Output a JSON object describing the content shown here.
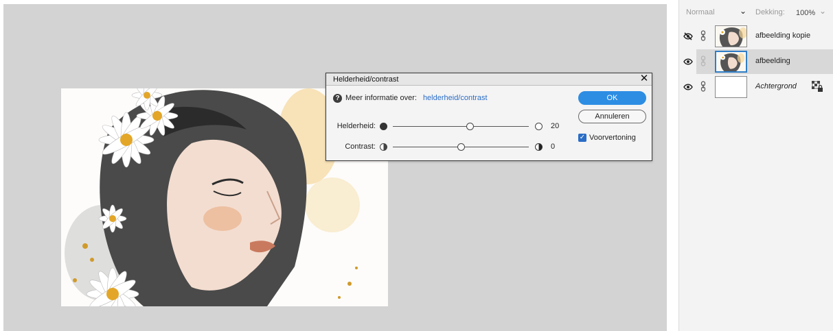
{
  "dialog": {
    "title": "Helderheid/contrast",
    "close_glyph": "✕",
    "info_label": "Meer informatie over:",
    "info_link": "helderheid/contrast",
    "brightness": {
      "label": "Helderheid:",
      "value": "20",
      "level": 0.57
    },
    "contrast": {
      "label": "Contrast:",
      "value": "0",
      "level": 0.5
    },
    "ok_label": "OK",
    "cancel_label": "Annuleren",
    "preview_label": "Voorvertoning",
    "preview_checked": true
  },
  "layers_panel": {
    "blend_mode": "Normaal",
    "opacity_label": "Dekking:",
    "opacity_value": "100%",
    "layers": [
      {
        "name": "afbeelding kopie",
        "visible": false,
        "selected": false
      },
      {
        "name": "afbeelding",
        "visible": true,
        "selected": true
      },
      {
        "name": "Achtergrond",
        "visible": true,
        "selected": false,
        "locked": true
      }
    ]
  },
  "colors": {
    "accent": "#2d8de3",
    "link": "#2a6dc6",
    "workspace": "#d3d3d3"
  }
}
